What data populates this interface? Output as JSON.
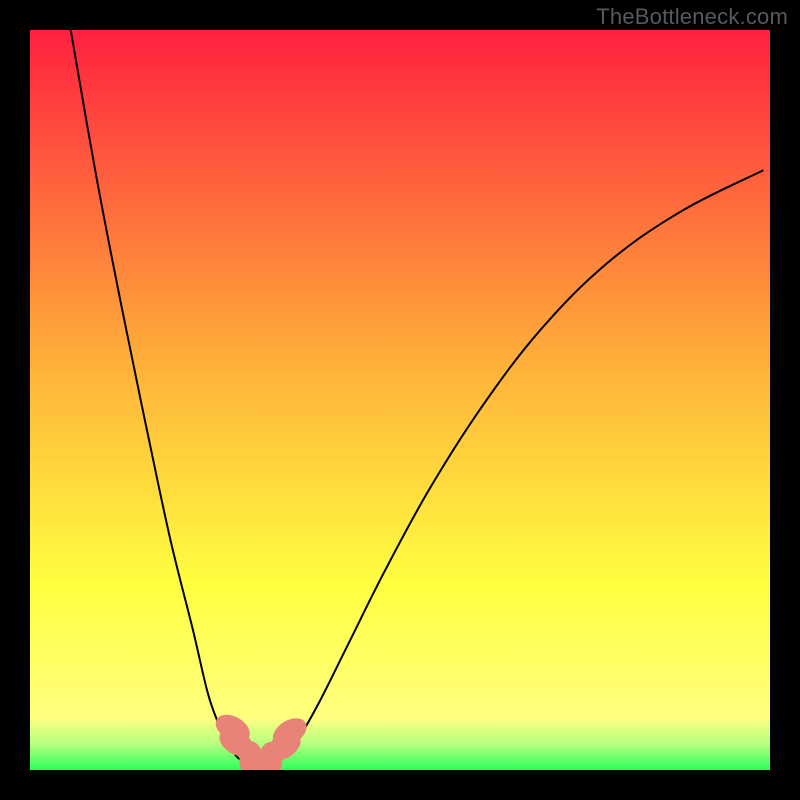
{
  "watermark": "TheBottleneck.com",
  "chart_data": {
    "type": "line",
    "title": "",
    "xlabel": "",
    "ylabel": "",
    "xlim": [
      0,
      100
    ],
    "ylim": [
      0,
      100
    ],
    "gradient_stops": [
      {
        "offset": 0.0,
        "color": "#ff203f"
      },
      {
        "offset": 0.45,
        "color": "#ffb03a"
      },
      {
        "offset": 0.75,
        "color": "#ffff40"
      },
      {
        "offset": 0.93,
        "color": "#ffff80"
      },
      {
        "offset": 0.965,
        "color": "#b4ff80"
      },
      {
        "offset": 1.0,
        "color": "#2bff5a"
      }
    ],
    "series": [
      {
        "name": "left-branch",
        "x": [
          5.5,
          9,
          12.5,
          16,
          19,
          22,
          24,
          25.5,
          26.8,
          27.5,
          28.3
        ],
        "y": [
          100,
          80,
          62,
          45,
          31,
          19,
          10.5,
          6.2,
          3.6,
          2.4,
          1.5
        ]
      },
      {
        "name": "floor",
        "x": [
          28.3,
          29.5,
          31,
          32.5,
          34
        ],
        "y": [
          1.5,
          1.2,
          1.05,
          1.15,
          1.5
        ]
      },
      {
        "name": "right-branch",
        "x": [
          34,
          36,
          39,
          43,
          48,
          54,
          61,
          69,
          78,
          88,
          99
        ],
        "y": [
          1.5,
          3.8,
          9,
          17,
          27,
          38,
          49,
          59.5,
          68.5,
          75.5,
          81
        ]
      }
    ],
    "markers": [
      {
        "x": 27.4,
        "y": 5.6,
        "rx": 1.6,
        "ry": 2.5,
        "angle": -60
      },
      {
        "x": 27.9,
        "y": 3.7,
        "rx": 1.6,
        "ry": 2.5,
        "angle": -60
      },
      {
        "x": 29.9,
        "y": 1.35,
        "rx": 1.6,
        "ry": 2.5,
        "angle": 0
      },
      {
        "x": 32.5,
        "y": 1.28,
        "rx": 1.6,
        "ry": 2.5,
        "angle": 0
      },
      {
        "x": 34.3,
        "y": 3.2,
        "rx": 1.6,
        "ry": 2.5,
        "angle": 58
      },
      {
        "x": 35.1,
        "y": 5.1,
        "rx": 1.6,
        "ry": 2.5,
        "angle": 58
      }
    ]
  }
}
